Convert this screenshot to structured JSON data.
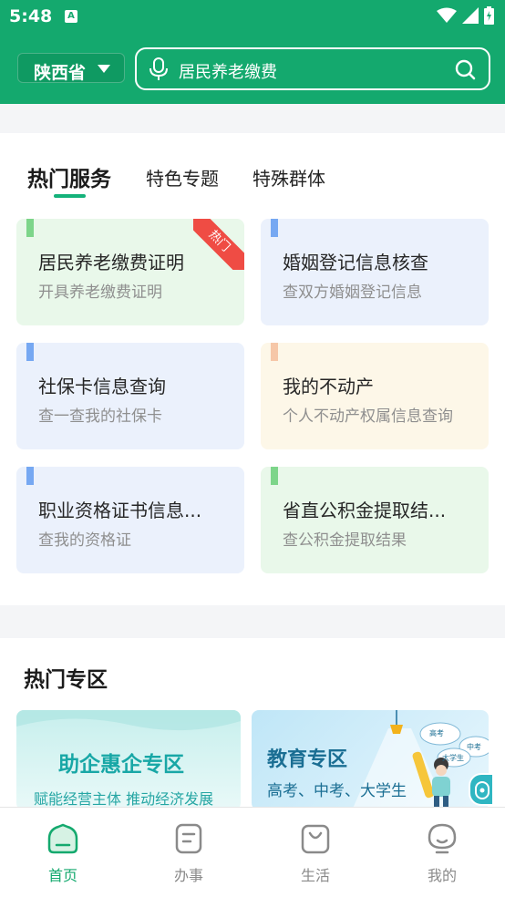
{
  "status_bar": {
    "time": "5:48",
    "badge": "A"
  },
  "header": {
    "province": "陕西省",
    "search_text": "居民养老缴费"
  },
  "tabs": [
    {
      "label": "热门服务",
      "active": true
    },
    {
      "label": "特色专题",
      "active": false
    },
    {
      "label": "特殊群体",
      "active": false
    }
  ],
  "services": [
    {
      "title": "居民养老缴费证明",
      "subtitle": "开具养老缴费证明",
      "theme": "green",
      "badge": "热门"
    },
    {
      "title": "婚姻登记信息核查",
      "subtitle": "查双方婚姻登记信息",
      "theme": "blue"
    },
    {
      "title": "社保卡信息查询",
      "subtitle": "查一查我的社保卡",
      "theme": "blue"
    },
    {
      "title": "我的不动产",
      "subtitle": "个人不动产权属信息查询",
      "theme": "yellow"
    },
    {
      "title": "职业资格证书信息...",
      "subtitle": "查我的资格证",
      "theme": "blue"
    },
    {
      "title": "省直公积金提取结...",
      "subtitle": "查公积金提取结果",
      "theme": "green"
    }
  ],
  "hot_zone": {
    "title": "热门专区",
    "banners": [
      {
        "title": "助企惠企专区",
        "subtitle": "赋能经营主体 推动经济发展"
      },
      {
        "title": "教育专区",
        "subtitle": "高考、中考、大学生",
        "tags": [
          "高考",
          "中考",
          "大学生"
        ]
      }
    ]
  },
  "bottom_nav": [
    {
      "label": "首页",
      "active": true
    },
    {
      "label": "办事",
      "active": false
    },
    {
      "label": "生活",
      "active": false
    },
    {
      "label": "我的",
      "active": false
    }
  ],
  "colors": {
    "primary": "#14a96e",
    "card_green": "#e9f8ea",
    "card_blue": "#ebf1fc",
    "card_yellow": "#fdf7e8",
    "hot_badge": "#ef4c44"
  }
}
